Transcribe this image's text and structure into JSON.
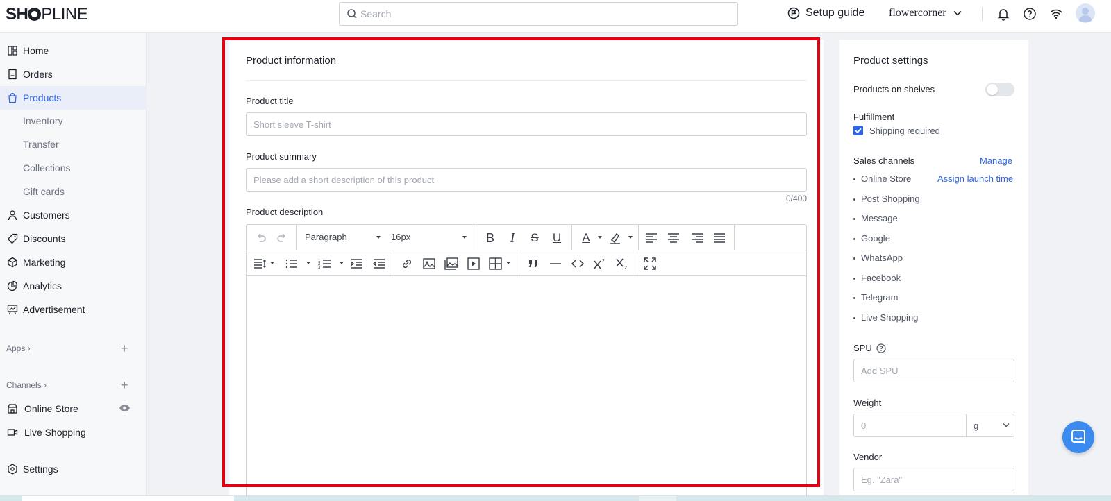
{
  "header": {
    "logo": "SHOPLINE",
    "search_placeholder": "Search",
    "setup_guide": "Setup guide",
    "store_name": "flowercorner"
  },
  "sidebar": {
    "items": [
      {
        "label": "Home",
        "icon": "home-icon"
      },
      {
        "label": "Orders",
        "icon": "orders-icon"
      },
      {
        "label": "Products",
        "icon": "bag-icon"
      },
      {
        "label": "Customers",
        "icon": "user-icon"
      },
      {
        "label": "Discounts",
        "icon": "tag-icon"
      },
      {
        "label": "Marketing",
        "icon": "cube-icon"
      },
      {
        "label": "Analytics",
        "icon": "pie-chart-icon"
      },
      {
        "label": "Advertisement",
        "icon": "board-icon"
      }
    ],
    "product_subitems": [
      "Inventory",
      "Transfer",
      "Collections",
      "Gift cards"
    ],
    "apps_label": "Apps",
    "channels_label": "Channels",
    "channels": [
      {
        "label": "Online Store",
        "icon": "store-icon"
      },
      {
        "label": "Live Shopping",
        "icon": "video-icon"
      }
    ],
    "settings_label": "Settings"
  },
  "product_info": {
    "title": "Product information",
    "title_label": "Product title",
    "title_placeholder": "Short sleeve T-shirt",
    "summary_label": "Product summary",
    "summary_placeholder": "Please add a short description of this product",
    "summary_counter": "0/400",
    "description_label": "Product description",
    "editor": {
      "paragraph_select": "Paragraph",
      "size_select": "16px",
      "bold": "B",
      "italic": "I",
      "strike": "S",
      "underline": "U",
      "text_color": "A"
    }
  },
  "settings": {
    "title": "Product settings",
    "on_shelves": "Products on shelves",
    "on_shelves_enabled": false,
    "fulfillment": "Fulfillment",
    "shipping_required": "Shipping required",
    "shipping_checked": true,
    "sales_channels": "Sales channels",
    "manage": "Manage",
    "assign_launch_time": "Assign launch time",
    "channels": [
      "Online Store",
      "Post Shopping",
      "Message",
      "Google",
      "WhatsApp",
      "Facebook",
      "Telegram",
      "Live Shopping"
    ],
    "spu_label": "SPU",
    "spu_placeholder": "Add SPU",
    "weight_label": "Weight",
    "weight_placeholder": "0",
    "weight_unit": "g",
    "vendor_label": "Vendor",
    "vendor_placeholder": "Eg. \"Zara\""
  },
  "colors": {
    "accent": "#2e65e8",
    "highlight_border": "#e60012",
    "chat_button": "#3b8af0"
  }
}
